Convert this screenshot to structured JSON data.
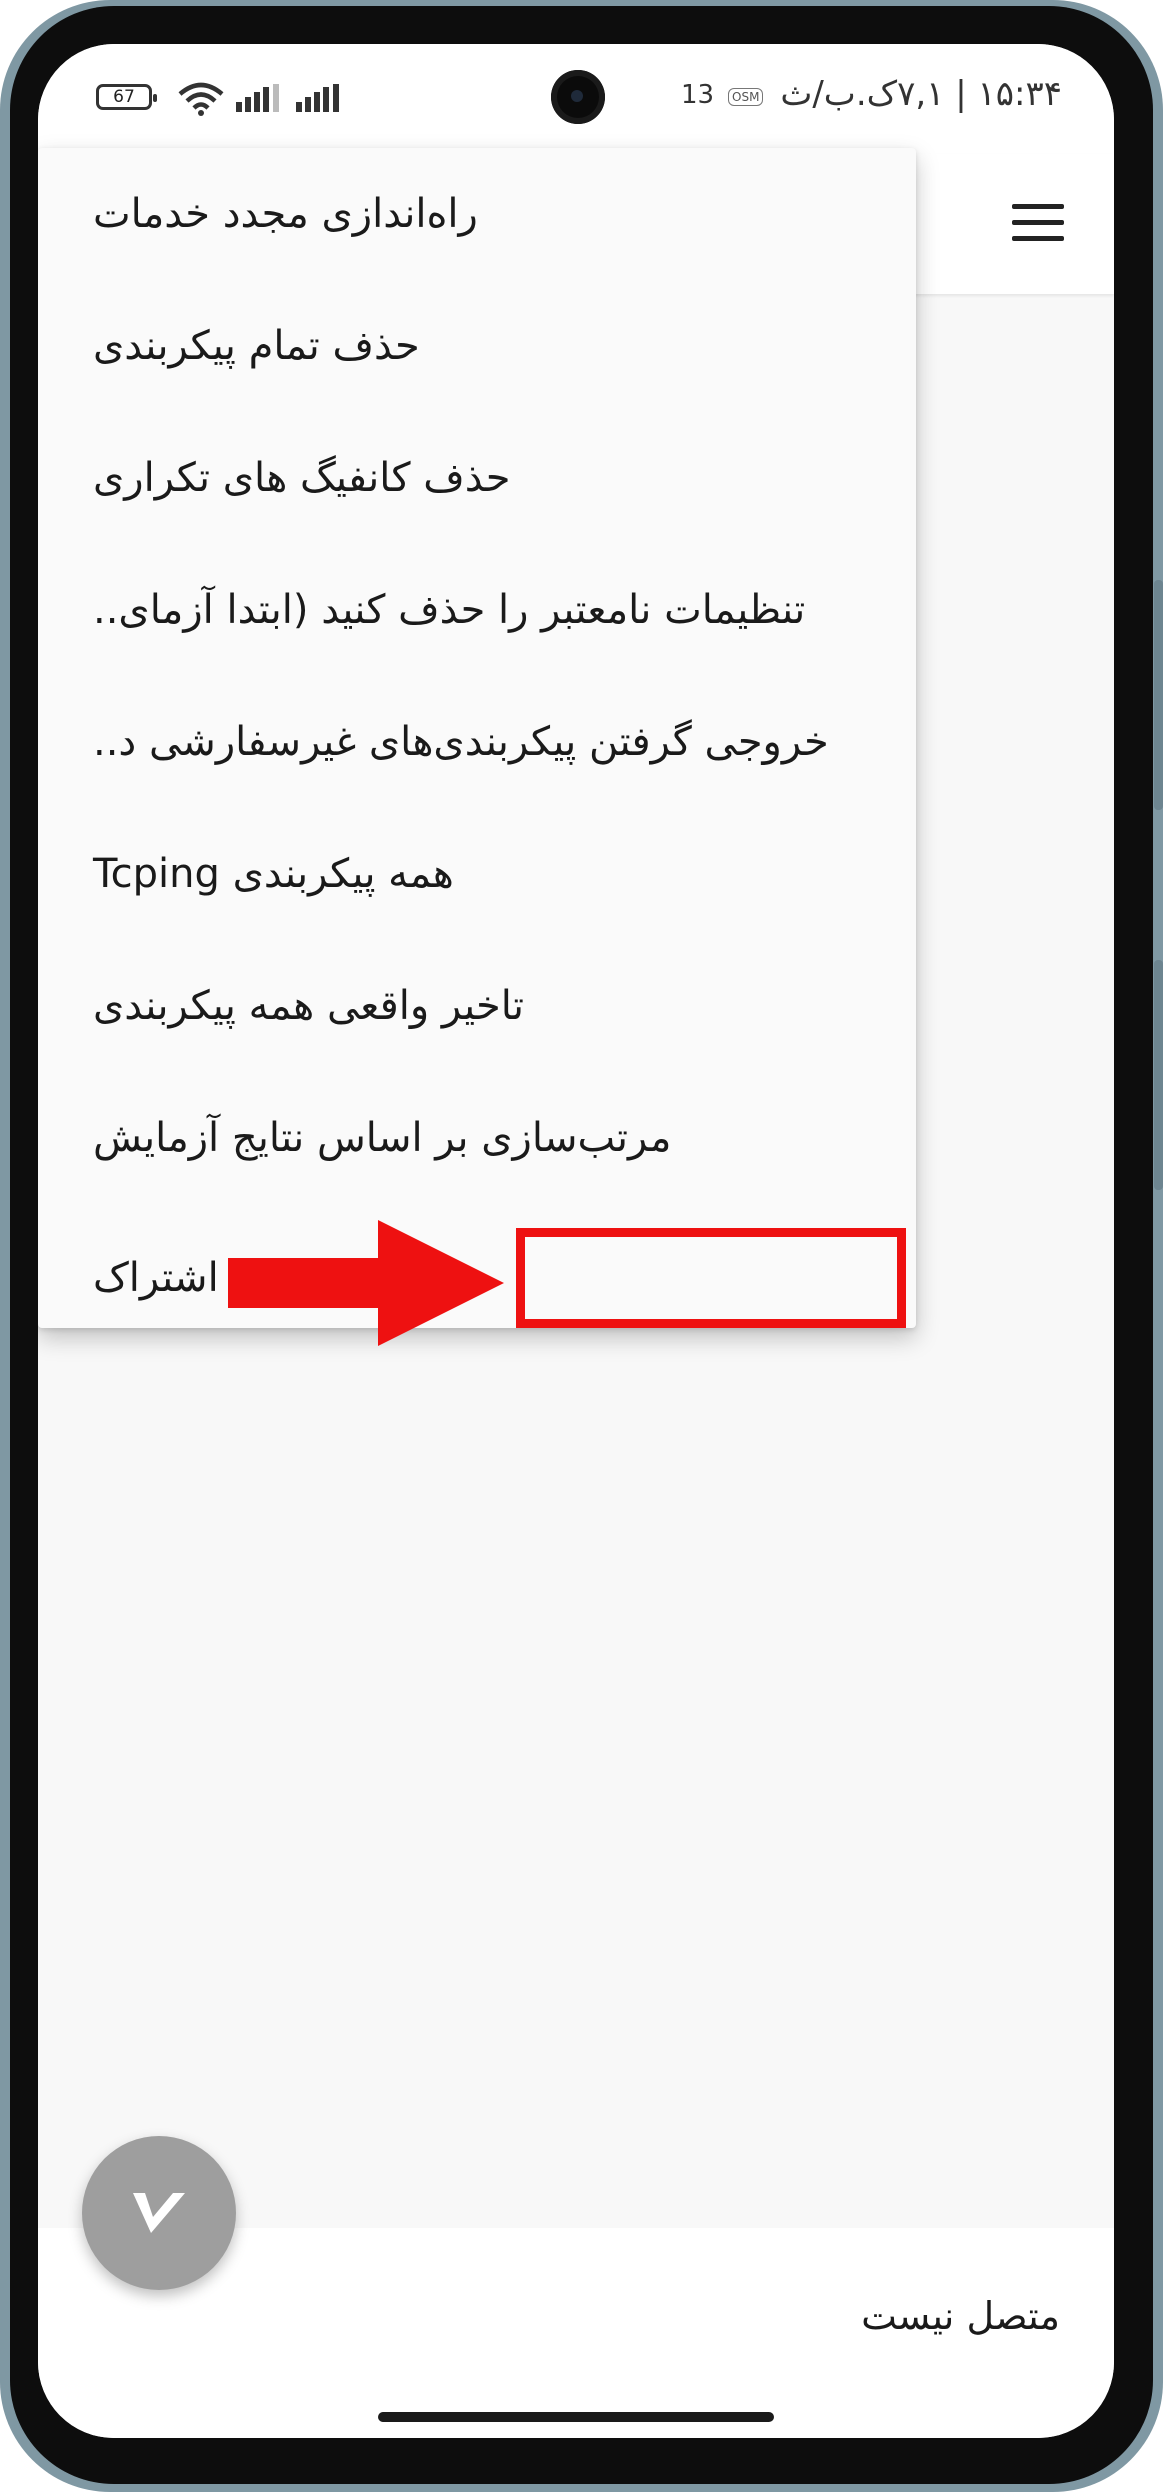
{
  "status_bar": {
    "battery": "67",
    "time_and_speed": "۱۵:۳۴ | ۷,۱ک.ب/ث",
    "tag": "OSM",
    "network_label": "13"
  },
  "menu": {
    "items": [
      {
        "label": "راه‌اندازی مجدد خدمات"
      },
      {
        "label": "حذف تمام پیکربندی"
      },
      {
        "label": "حذف کانفیگ های تکراری"
      },
      {
        "label": "تنظیمات نامعتبر را حذف کنید (ابتدا آزمای.."
      },
      {
        "label": "خروجی گرفتن پیکربندی‌های غیرسفارشی د.."
      },
      {
        "label": "همه پیکربندی Tcping"
      },
      {
        "label": "تاخیر واقعی همه پیکربندی"
      },
      {
        "label": "مرتب‌سازی بر اساس نتایج آزمایش"
      },
      {
        "label": "به‌روزرسانی اشتراک"
      }
    ]
  },
  "bottom": {
    "connection_status": "متصل نیست"
  },
  "colors": {
    "highlight": "#ee1111",
    "fab": "#9e9e9e",
    "frame": "#7f98a3"
  },
  "icons": {
    "menu": "hamburger-icon",
    "fab": "v-logo-icon",
    "annotation": "red-arrow-icon"
  }
}
